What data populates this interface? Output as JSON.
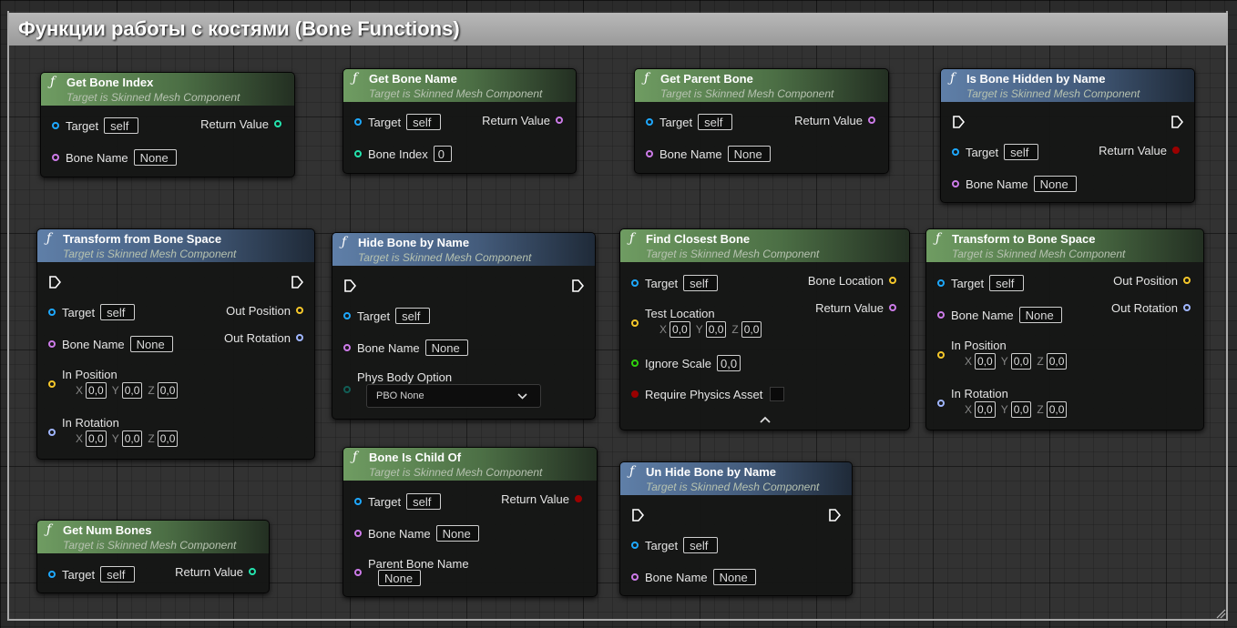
{
  "comment": {
    "title": "Функции работы с костями (Bone Functions)"
  },
  "common": {
    "subtitle": "Target is Skinned Mesh Component",
    "target": "Target",
    "self": "self",
    "bone_name": "Bone Name",
    "none": "None",
    "return_value": "Return Value",
    "in_position": "In Position",
    "in_rotation": "In Rotation",
    "out_position": "Out Position",
    "out_rotation": "Out Rotation",
    "x": "X",
    "y": "Y",
    "z": "Z",
    "zero": "0,0"
  },
  "nodes": {
    "get_bone_index": {
      "title": "Get Bone Index"
    },
    "get_bone_name": {
      "title": "Get Bone Name",
      "bone_index": "Bone Index",
      "bone_index_value": "0"
    },
    "get_parent_bone": {
      "title": "Get Parent Bone"
    },
    "is_bone_hidden": {
      "title": "Is Bone Hidden by Name"
    },
    "transform_from": {
      "title": "Transform from Bone Space"
    },
    "hide_bone": {
      "title": "Hide Bone by Name",
      "phys_body_option": "Phys Body Option",
      "pbo_value": "PBO None"
    },
    "find_closest": {
      "title": "Find Closest Bone",
      "bone_location": "Bone Location",
      "test_location": "Test Location",
      "ignore_scale": "Ignore Scale",
      "require_physics": "Require Physics Asset"
    },
    "transform_to": {
      "title": "Transform to Bone Space"
    },
    "bone_is_child": {
      "title": "Bone Is Child Of",
      "parent_bone_name": "Parent Bone Name"
    },
    "unhide_bone": {
      "title": "Un Hide Bone by Name"
    },
    "get_num_bones": {
      "title": "Get Num Bones"
    }
  },
  "colors": {
    "object_pin": "#1ea8ff",
    "name_pin": "#cc7be8",
    "int_pin": "#24e2ad",
    "vector_pin": "#f6c72a",
    "rotator_pin": "#a0b6ff",
    "bool_pin": "#9b0000",
    "float_pin": "#2fd20e",
    "pure_header": "#6f9c62",
    "impure_header": "#5f7fa8"
  },
  "icons": [
    "function-icon",
    "exec-pin-icon",
    "chevron-down-icon",
    "chevron-up-icon",
    "resize-grip-icon"
  ]
}
